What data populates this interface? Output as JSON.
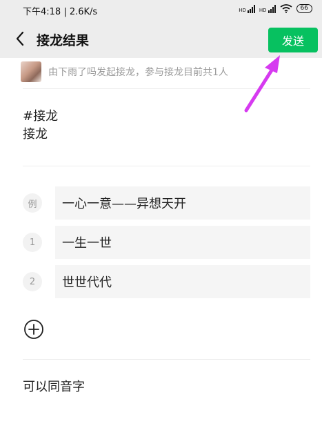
{
  "status_bar": {
    "time_speed": "下午4:18 | 2.6K/s",
    "signal1_label": "HD",
    "signal2_label": "HD",
    "battery": "66"
  },
  "header": {
    "title": "接龙结果",
    "send_label": "发送"
  },
  "info": {
    "text": "由下雨了吗发起接龙，参与接龙目前共1人"
  },
  "topic": {
    "line1": "#接龙",
    "line2": "接龙"
  },
  "entries": [
    {
      "num": "例",
      "text": "一心一意——异想天开"
    },
    {
      "num": "1",
      "text": "一生一世"
    },
    {
      "num": "2",
      "text": "世世代代"
    }
  ],
  "note": {
    "text": "可以同音字"
  },
  "colors": {
    "accent": "#07c160",
    "annotation_arrow": "#d63af0",
    "bar_bg": "#ededed"
  },
  "icons": {
    "back": "chevron-left-icon",
    "add": "plus-circle-icon",
    "wifi": "wifi-icon"
  }
}
